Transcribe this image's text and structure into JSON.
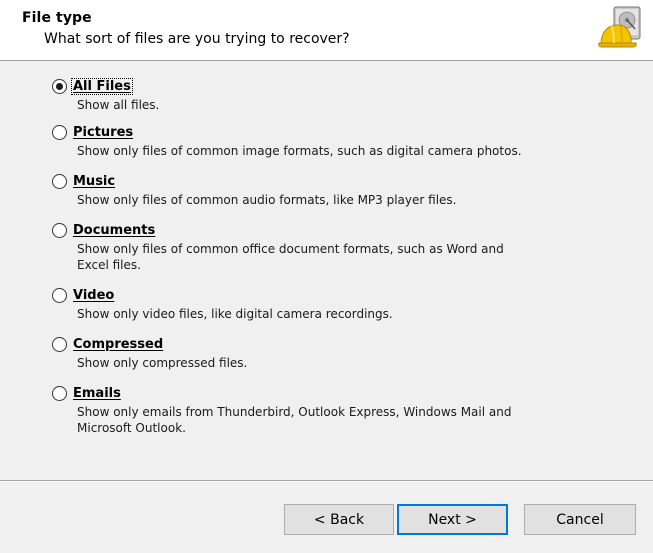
{
  "header": {
    "title": "File type",
    "subtitle": "What sort of files are you trying to recover?",
    "icon": "hard-drive-with-hardhat-icon"
  },
  "options": [
    {
      "label": "All Files",
      "description": "Show all files.",
      "selected": true
    },
    {
      "label": "Pictures",
      "description": "Show only files of common image formats, such as digital camera photos.",
      "selected": false
    },
    {
      "label": "Music",
      "description": "Show only files of common audio formats, like MP3 player files.",
      "selected": false
    },
    {
      "label": "Documents",
      "description": "Show only files of common office document formats, such as Word and Excel files.",
      "selected": false
    },
    {
      "label": "Video",
      "description": "Show only video files, like digital camera recordings.",
      "selected": false
    },
    {
      "label": "Compressed",
      "description": "Show only compressed files.",
      "selected": false
    },
    {
      "label": "Emails",
      "description": "Show only emails from Thunderbird, Outlook Express, Windows Mail and Microsoft Outlook.",
      "selected": false
    }
  ],
  "buttons": {
    "back": "< Back",
    "next": "Next >",
    "cancel": "Cancel"
  },
  "colors": {
    "default_button_border": "#0078d7",
    "dialog_background": "#f0f0f0",
    "header_background": "#ffffff"
  }
}
